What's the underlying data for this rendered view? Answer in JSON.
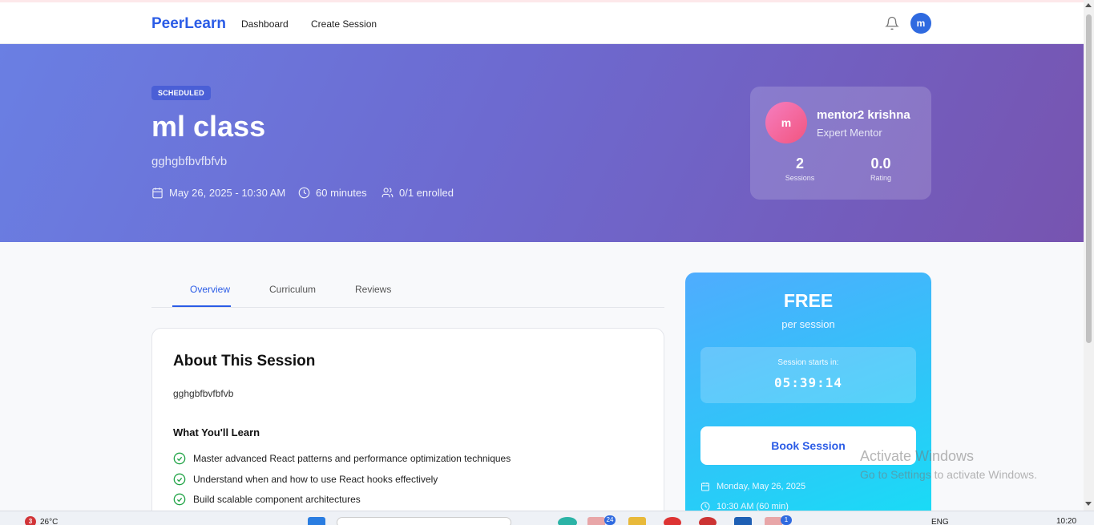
{
  "header": {
    "brand": "PeerLearn",
    "nav": [
      "Dashboard",
      "Create Session"
    ],
    "avatar_initial": "m"
  },
  "hero": {
    "status_badge": "SCHEDULED",
    "title": "ml class",
    "subtitle": "gghgbfbvfbfvb",
    "date": "May 26, 2025 - 10:30 AM",
    "duration": "60 minutes",
    "enrolled": "0/1 enrolled"
  },
  "mentor": {
    "initial": "m",
    "name": "mentor2 krishna",
    "role": "Expert Mentor",
    "sessions_value": "2",
    "sessions_label": "Sessions",
    "rating_value": "0.0",
    "rating_label": "Rating"
  },
  "tabs": [
    "Overview",
    "Curriculum",
    "Reviews"
  ],
  "active_tab": "Overview",
  "about": {
    "heading": "About This Session",
    "description": "gghgbfbvfbfvb",
    "learn_heading": "What You'll Learn",
    "learn_items": [
      "Master advanced React patterns and performance optimization techniques",
      "Understand when and how to use React hooks effectively",
      "Build scalable component architectures"
    ]
  },
  "booking": {
    "price": "FREE",
    "per": "per session",
    "countdown_label": "Session starts in:",
    "countdown": "05:39:14",
    "button": "Book Session",
    "date": "Monday, May 26, 2025",
    "time": "10:30 AM (60 min)"
  },
  "watermark": {
    "line1": "Activate Windows",
    "line2": "Go to Settings to activate Windows."
  },
  "taskbar": {
    "weather_badge": "3",
    "temperature": "26°C",
    "app_badge_1": "24",
    "app_badge_2": "1",
    "language": "ENG",
    "time": "10:20"
  },
  "colors": {
    "brand": "#2b5ce6",
    "hero_start": "#6a7fe3",
    "hero_end": "#7754b0",
    "booking_start": "#4facfe",
    "booking_end": "#16dff6"
  }
}
